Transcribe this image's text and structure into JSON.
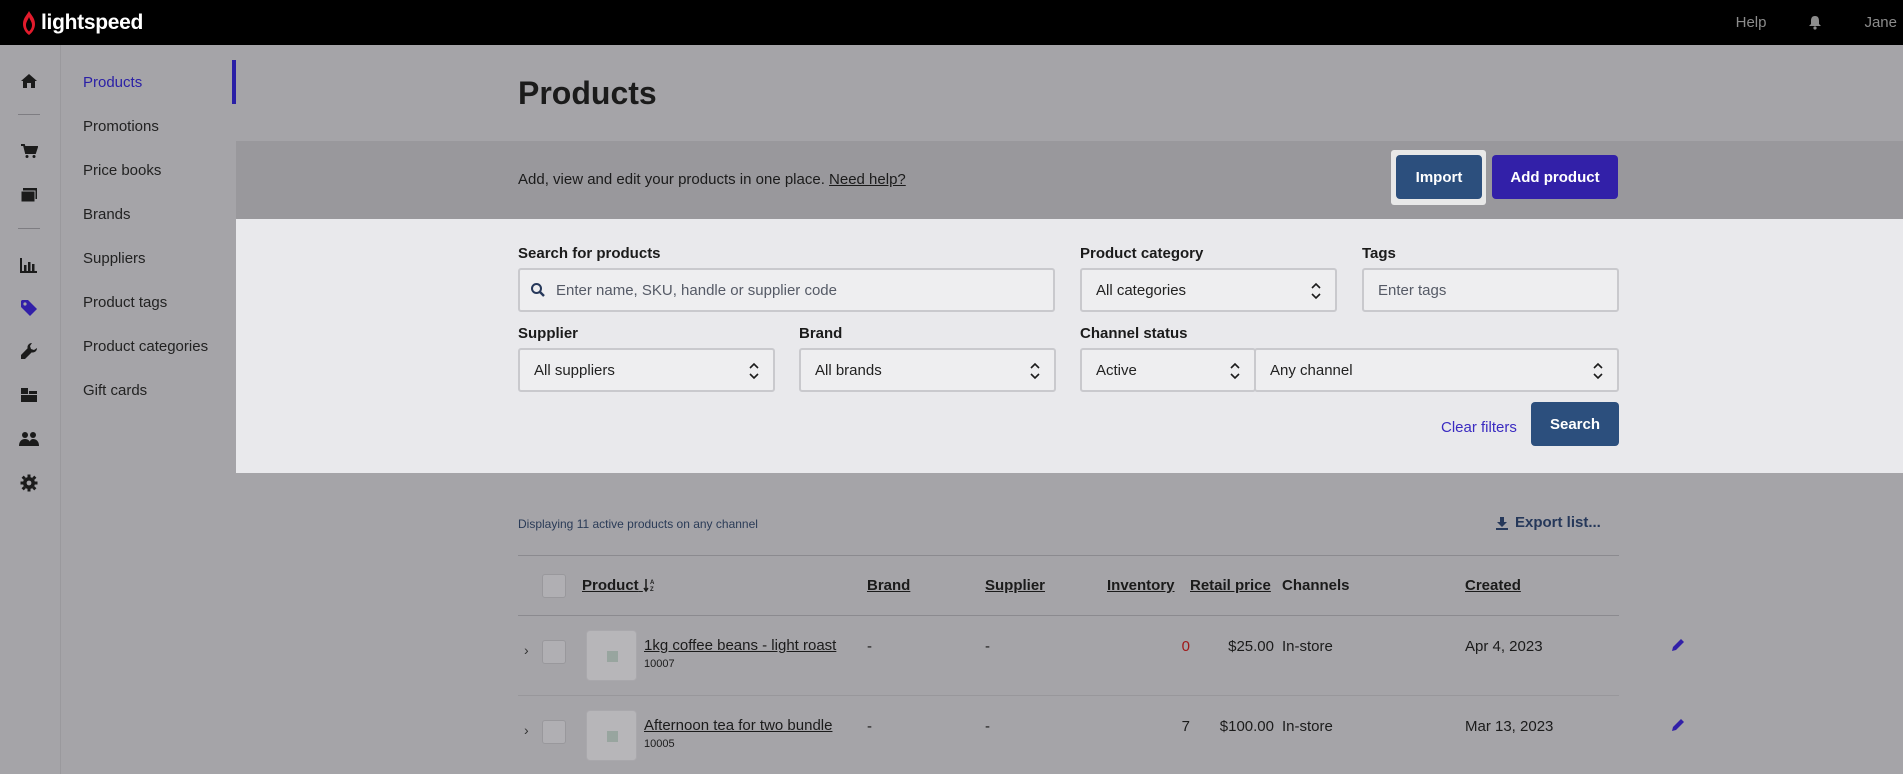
{
  "topbar": {
    "brand": "lightspeed",
    "help_label": "Help",
    "user_name": "Jane",
    "icons": [
      "lightspeed-logo-icon",
      "bell-icon"
    ]
  },
  "rail": {
    "icons": [
      "home-icon",
      "cart-icon",
      "register-icon",
      "reports-icon",
      "tag-icon",
      "wrench-icon",
      "inventory-icon",
      "customers-icon",
      "gear-icon"
    ],
    "active_icon": "tag-icon"
  },
  "subnav": {
    "items": [
      {
        "label": "Products",
        "active": true
      },
      {
        "label": "Promotions"
      },
      {
        "label": "Price books"
      },
      {
        "label": "Brands"
      },
      {
        "label": "Suppliers"
      },
      {
        "label": "Product tags"
      },
      {
        "label": "Product categories"
      },
      {
        "label": "Gift cards"
      }
    ]
  },
  "page": {
    "title": "Products",
    "banner_text": "Add, view and edit your products in one place.",
    "help_link": "Need help?",
    "import_label": "Import",
    "add_label": "Add product"
  },
  "filters": {
    "search": {
      "label": "Search for products",
      "placeholder": "Enter name, SKU, handle or supplier code"
    },
    "category": {
      "label": "Product category",
      "value": "All categories"
    },
    "tags": {
      "label": "Tags",
      "placeholder": "Enter tags"
    },
    "supplier": {
      "label": "Supplier",
      "value": "All suppliers"
    },
    "brand": {
      "label": "Brand",
      "value": "All brands"
    },
    "channel_status": {
      "label": "Channel status",
      "status_value": "Active",
      "channel_value": "Any channel"
    },
    "clear_label": "Clear filters",
    "search_label": "Search"
  },
  "list": {
    "count_text": "Displaying 11 active products on any channel",
    "export_label": "Export list...",
    "columns": {
      "product": "Product",
      "brand": "Brand",
      "supplier": "Supplier",
      "inventory": "Inventory",
      "retail_price": "Retail price",
      "channels": "Channels",
      "created": "Created"
    },
    "rows": [
      {
        "name": "1kg coffee beans - light roast",
        "sku": "10007",
        "brand": "-",
        "supplier": "-",
        "inventory": "0",
        "price": "$25.00",
        "channels": "In-store",
        "created": "Apr 4, 2023"
      },
      {
        "name": "Afternoon tea for two bundle",
        "sku": "10005",
        "brand": "-",
        "supplier": "-",
        "inventory": "7",
        "price": "$100.00",
        "channels": "In-store",
        "created": "Mar 13, 2023"
      }
    ]
  },
  "colors": {
    "accent": "#3220a8",
    "primary_button": "#2c4f7d",
    "topbar": "#000000",
    "negative": "#a01818"
  }
}
